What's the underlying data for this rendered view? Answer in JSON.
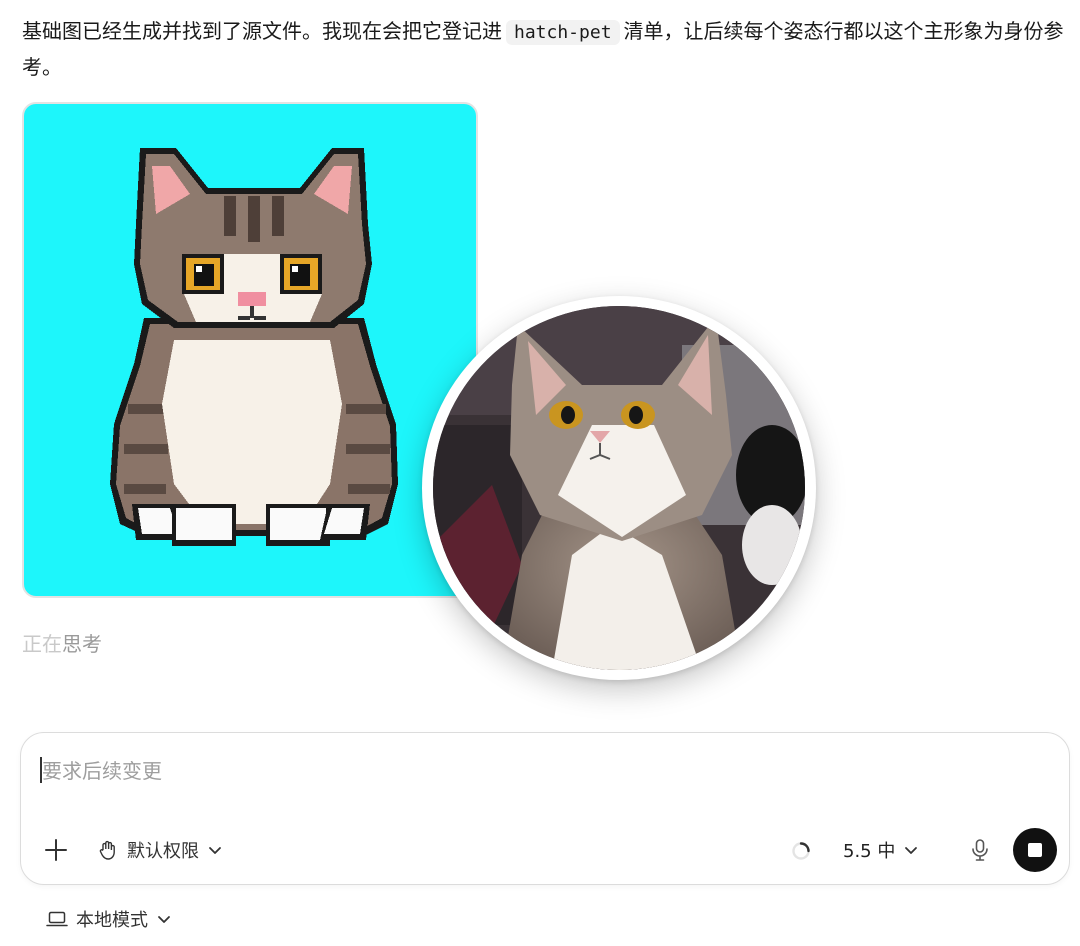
{
  "message": {
    "text_before": "基础图已经生成并找到了源文件。我现在会把它登记进",
    "code": "hatch-pet",
    "text_after": "清单，让后续每个姿态行都以这个主形象为身份参考。"
  },
  "status": {
    "thinking_dim": "正在",
    "thinking_rest": "思考"
  },
  "composer": {
    "placeholder": "要求后续变更",
    "permission_label": "默认权限",
    "model_label": "5.5 中"
  },
  "footer": {
    "mode_label": "本地模式"
  },
  "icons": [
    "plus-icon",
    "hand-icon",
    "chevron-down-icon",
    "spinner-icon",
    "microphone-icon",
    "stop-icon",
    "laptop-icon"
  ],
  "colors": {
    "pixel_bg": "#1df6fb",
    "stop_button": "#111111"
  }
}
